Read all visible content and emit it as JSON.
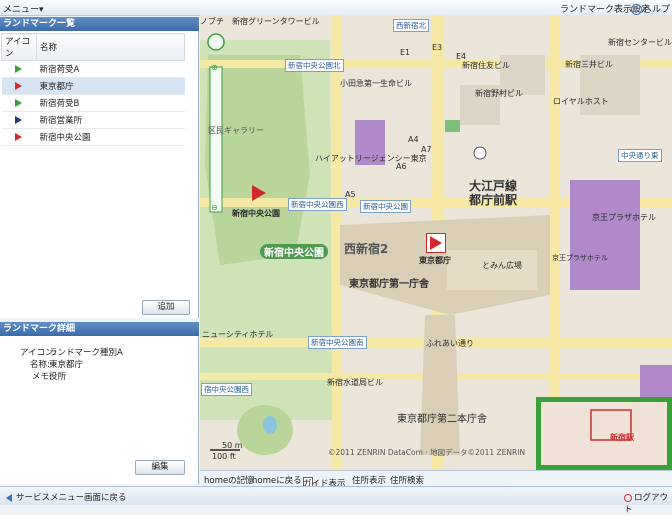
{
  "topbar": {
    "menu": "メニュー▾",
    "settings": "ランドマーク表示設定",
    "help": "ヘルプ"
  },
  "landmark_list": {
    "title": "ランドマーク一覧",
    "columns": [
      "アイコン",
      "名称"
    ],
    "rows": [
      {
        "name": "新宿荷受A",
        "color": "#3aa03a"
      },
      {
        "name": "東京都庁",
        "color": "#d22a2a"
      },
      {
        "name": "新宿荷受B",
        "color": "#3aa03a"
      },
      {
        "name": "新宿営業所",
        "color": "#26407a"
      },
      {
        "name": "新宿中央公園",
        "color": "#d22a2a"
      }
    ],
    "add_label": "追加"
  },
  "landmark_detail": {
    "title": "ランドマーク詳細",
    "icon_label": "アイコン:",
    "icon_value": "ランドマーク種別A",
    "name_label": "名称:",
    "name_value": "東京都庁",
    "memo_label": "メモ:",
    "memo_value": "役所",
    "edit_label": "編集"
  },
  "map": {
    "labels": {
      "green_tower": "新宿グリーンタワービル",
      "nishi_kita": "西新宿北",
      "chuo_kita": "新宿中央公園北",
      "odakyu": "小田急第一生命ビル",
      "sumitomo": "新宿住友ビル",
      "mitsui": "新宿三井ビル",
      "center": "新宿センタービル",
      "nomura": "新宿野村ビル",
      "royal_host": "ロイヤルホスト",
      "hyatt": "ハイアットリージェンシー東京",
      "oedo": "大江戸線",
      "tochomae": "都庁前駅",
      "chuo_dori": "中央通り東",
      "keio_plaza": "京王プラザホテル",
      "station_stop": "新宿中央公園",
      "chuo_koen_w": "新宿中央公園西",
      "nishishinjuku2": "西新宿2",
      "flag_tocho": "東京都庁",
      "tocho1": "東京都庁第一庁舎",
      "park_label": "新宿中央公園",
      "flag_park": "新宿中央公園",
      "dome": "とみん広場",
      "keio_plaza2": "京王プラザホテル",
      "gallery": "区民ギャラリー",
      "new_city": "ニューシティホテル",
      "chuo_koen_minami": "新宿中央公園南",
      "fureai": "ふれあい通り",
      "suido": "新宿水道局ビル",
      "tocho2": "東京都庁第二本庁舎",
      "chuo_koen_nishi": "宿中央公園西",
      "shinjuku_eki": "新宿駅",
      "scale_50": "50 m",
      "scale_100": "100 ft",
      "copyright": "©2011 ZENRIN DataCom · 地図データ©2011 ZENRIN",
      "zoom_label": "ノブチ",
      "road_a4": "A4",
      "road_a5": "A5",
      "road_a6": "A6",
      "road_a7": "A7",
      "road_e1": "E1",
      "road_e3": "E3",
      "road_e4": "E4"
    }
  },
  "map_footer": {
    "home_mem": "homeの記憶",
    "home_back": "homeに戻る",
    "guide": "ガイド表示",
    "addr_show": "住所表示",
    "addr_search": "住所検索"
  },
  "bottombar": {
    "back": "サービスメニュー画面に戻る",
    "logout": "ログアウト"
  }
}
